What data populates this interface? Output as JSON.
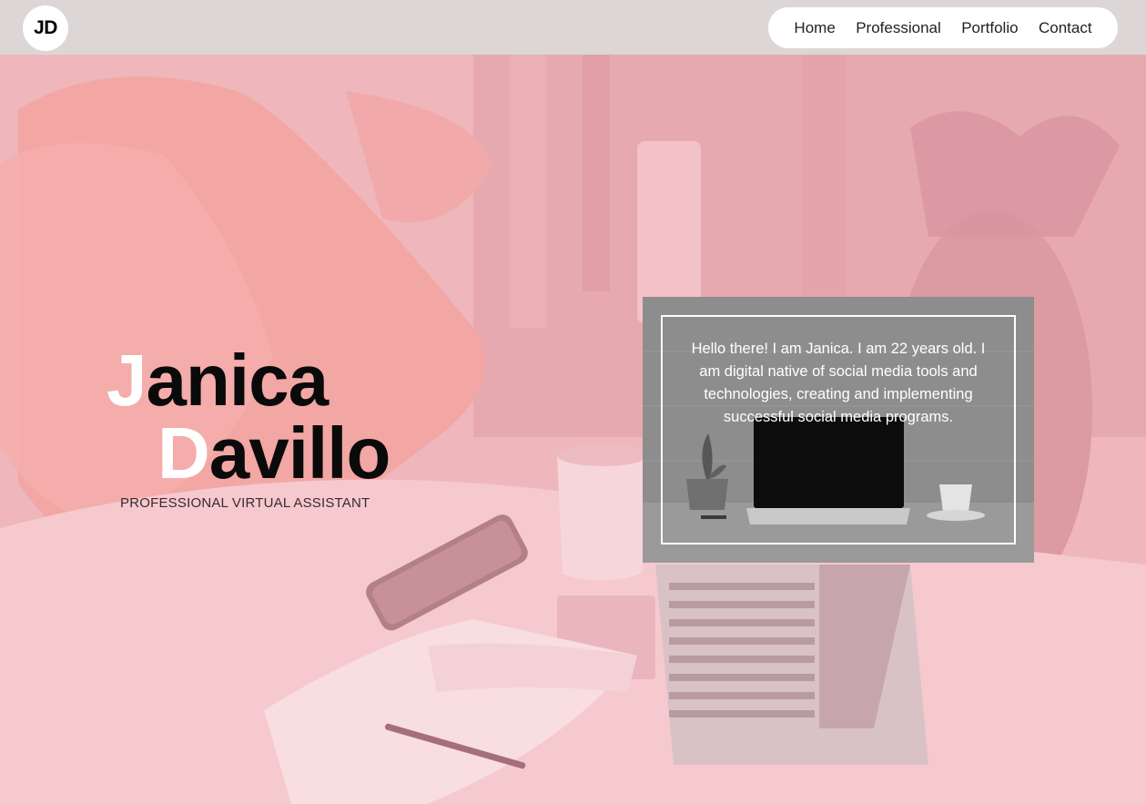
{
  "logo": {
    "text": "JD"
  },
  "nav": {
    "items": [
      {
        "label": "Home"
      },
      {
        "label": "Professional"
      },
      {
        "label": "Portfolio"
      },
      {
        "label": "Contact"
      }
    ]
  },
  "hero": {
    "first_initial": "J",
    "first_rest": "anica",
    "last_initial": "D",
    "last_rest": "avillo",
    "subtitle": "PROFESSIONAL VIRTUAL ASSISTANT",
    "background_image": "pink-tinted-bed-workspace-photo"
  },
  "intro_card": {
    "text": "Hello there! I am Janica. I am 22 years old. I am digital native of social media tools and technologies, creating and implementing successful social media programs.",
    "background_image": "grayscale-desk-laptop-photo"
  },
  "colors": {
    "topbar": "#dcd6d7",
    "hero_tint": "#f0b7bd",
    "name_text": "#0a0a0a",
    "initials": "#ffffff",
    "card_bg": "#8d8c8c"
  }
}
